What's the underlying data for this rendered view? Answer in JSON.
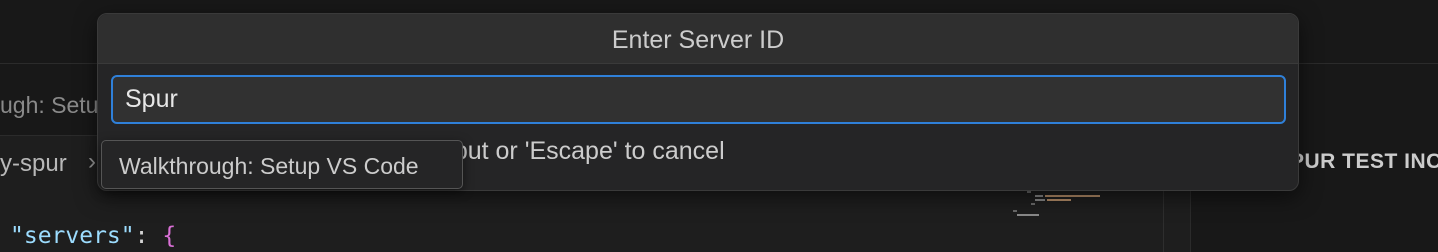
{
  "background": {
    "active_tab_label": "ugh: Setu",
    "breadcrumb_item": "y-spur",
    "breadcrumb_separator": "›",
    "code": {
      "key": "\"servers\"",
      "colon": ":",
      "brace": "{"
    },
    "side_panel_title": "PUR TEST INC"
  },
  "quick_input": {
    "title": "Enter Server ID",
    "input_value": "Spur",
    "message": "Press 'Enter' to confirm your input or 'Escape' to cancel"
  },
  "tooltip": {
    "text": "Walkthrough: Setup VS Code"
  },
  "colors": {
    "focus_border": "#2f80d9",
    "json_key": "#9cdcfe",
    "json_brace": "#da70d6"
  },
  "icons": {
    "breadcrumb_separator": "chevron-right-icon"
  }
}
